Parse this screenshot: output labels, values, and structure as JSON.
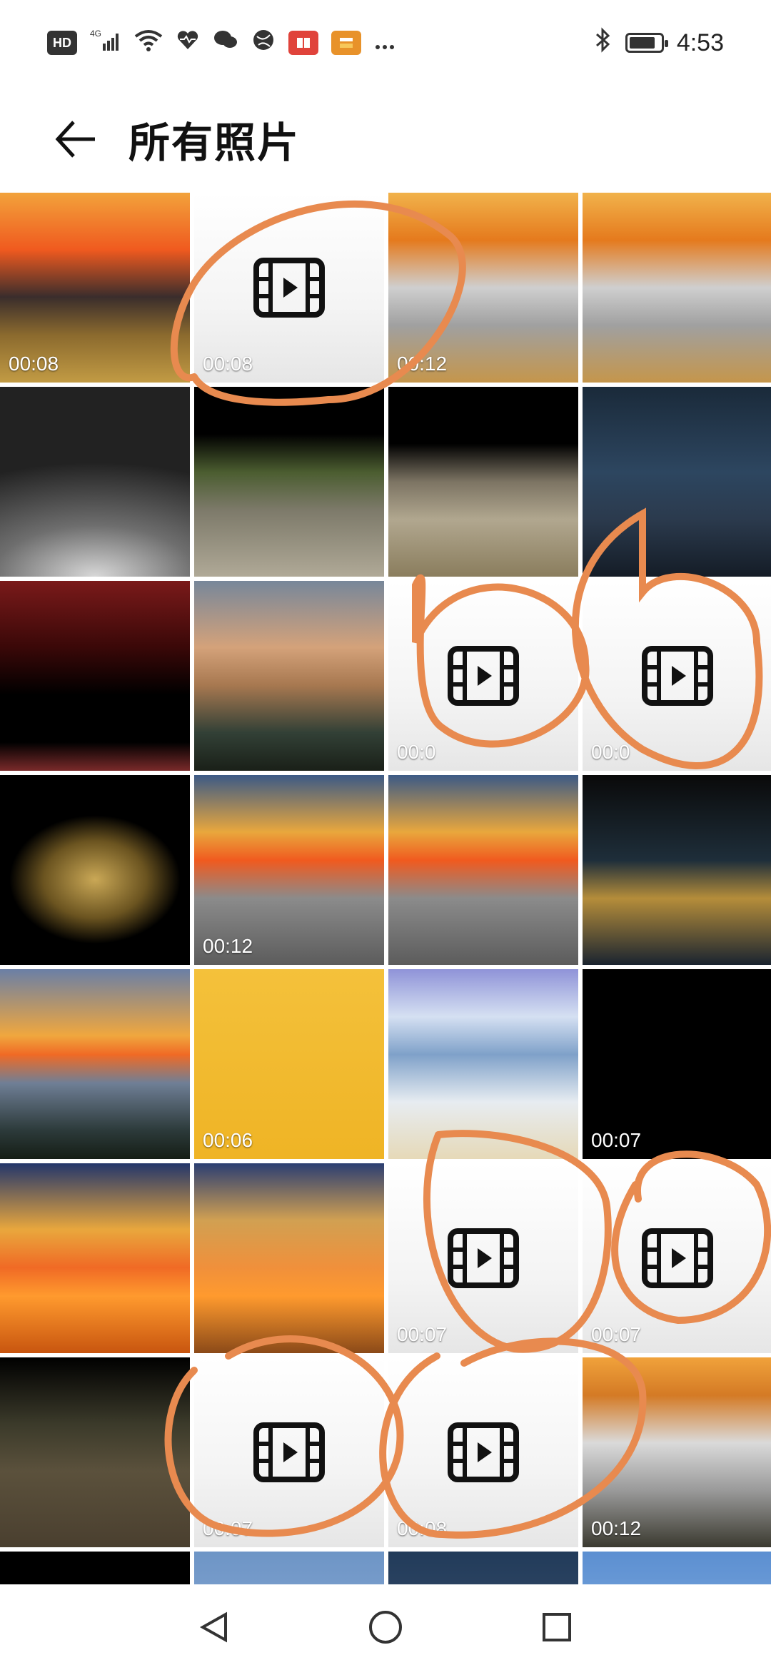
{
  "status_bar": {
    "left_labels": [
      "HD",
      "4G"
    ],
    "right_time": "4:53",
    "icons": [
      "hd-icon",
      "signal-4g-icon",
      "wifi-icon",
      "health-icon",
      "wechat-icon",
      "globe-icon",
      "book-app-icon",
      "shopping-app-icon",
      "more-dots-icon",
      "bluetooth-icon",
      "battery-icon"
    ]
  },
  "header": {
    "title": "所有照片",
    "back_icon": "arrow-left-icon"
  },
  "grid": {
    "items": [
      {
        "type": "photo",
        "duration": "00:08",
        "style": "sunset-palace"
      },
      {
        "type": "video",
        "duration": "00:08",
        "style": "video-placeholder"
      },
      {
        "type": "photo",
        "duration": "00:12",
        "style": "cliff-sea"
      },
      {
        "type": "photo",
        "duration": "",
        "style": "cliff-sea"
      },
      {
        "type": "photo",
        "duration": "",
        "style": "moon-dune"
      },
      {
        "type": "photo",
        "duration": "",
        "style": "great-wall"
      },
      {
        "type": "photo",
        "duration": "",
        "style": "railing"
      },
      {
        "type": "photo",
        "duration": "",
        "style": "pavilion-night"
      },
      {
        "type": "photo",
        "duration": "",
        "style": "red-tags"
      },
      {
        "type": "photo",
        "duration": "",
        "style": "cloud-dusk"
      },
      {
        "type": "video",
        "duration": "00:0",
        "style": "video-placeholder"
      },
      {
        "type": "video",
        "duration": "00:0",
        "style": "video-placeholder"
      },
      {
        "type": "photo",
        "duration": "",
        "style": "palace-black"
      },
      {
        "type": "photo",
        "duration": "00:12",
        "style": "swirl-sun"
      },
      {
        "type": "photo",
        "duration": "",
        "style": "swirl-sun"
      },
      {
        "type": "photo",
        "duration": "",
        "style": "corridor-night"
      },
      {
        "type": "photo",
        "duration": "",
        "style": "mountains-sea"
      },
      {
        "type": "photo",
        "duration": "00:06",
        "style": "crane-yellow"
      },
      {
        "type": "photo",
        "duration": "",
        "style": "sky-beach"
      },
      {
        "type": "photo",
        "duration": "00:07",
        "style": "black"
      },
      {
        "type": "photo",
        "duration": "",
        "style": "swirl-lake"
      },
      {
        "type": "photo",
        "duration": "",
        "style": "swirl-lake2"
      },
      {
        "type": "video",
        "duration": "00:07",
        "style": "video-placeholder"
      },
      {
        "type": "video",
        "duration": "00:07",
        "style": "video-placeholder"
      },
      {
        "type": "photo",
        "duration": "",
        "style": "cliff-house"
      },
      {
        "type": "video",
        "duration": "00:07",
        "style": "video-placeholder"
      },
      {
        "type": "video",
        "duration": "00:08",
        "style": "video-placeholder"
      },
      {
        "type": "photo",
        "duration": "00:12",
        "style": "waterfall-clouds"
      },
      {
        "type": "photo",
        "duration": "",
        "style": "black"
      },
      {
        "type": "photo",
        "duration": "",
        "style": "sky-blue"
      },
      {
        "type": "photo",
        "duration": "",
        "style": "night-stars"
      },
      {
        "type": "photo",
        "duration": "",
        "style": "sea-road"
      }
    ]
  },
  "annotations": {
    "color": "#e88a4f",
    "description_icons": [
      "annotation-circle"
    ]
  },
  "navbar": {
    "buttons": [
      "back-triangle-icon",
      "home-circle-icon",
      "recents-square-icon"
    ]
  }
}
